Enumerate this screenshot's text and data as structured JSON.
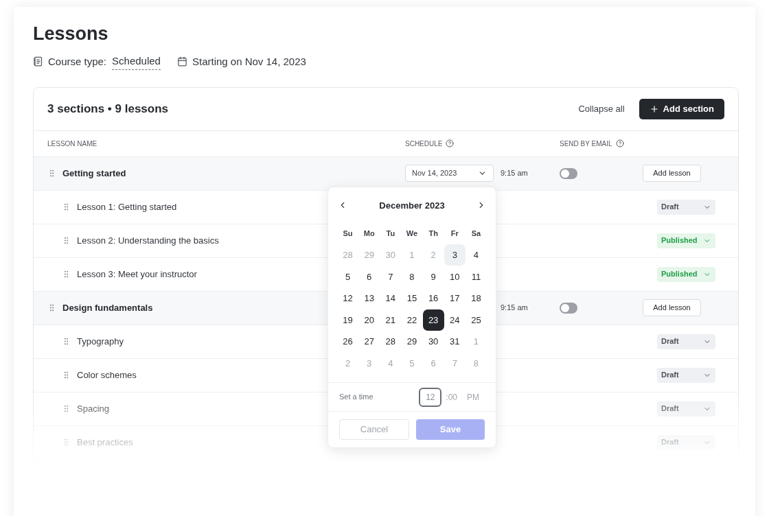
{
  "page": {
    "title": "Lessons",
    "course_type_label": "Course type:",
    "course_type": "Scheduled",
    "start": "Starting on Nov 14, 2023"
  },
  "table": {
    "summary": "3 sections • 9 lessons",
    "collapse": "Collapse all",
    "add_section": "Add section",
    "columns": [
      {
        "label": "LESSON NAME",
        "help": false
      },
      {
        "label": "SCHEDULE",
        "help": true
      },
      {
        "label": "SEND BY EMAIL",
        "help": true
      }
    ],
    "sections": [
      {
        "name": "Getting started",
        "date": "Nov 14, 2023",
        "time": "9:15 am",
        "email_on": false,
        "add": "Add lesson",
        "lessons": [
          {
            "name": "Lesson 1: Getting started",
            "status": "Draft",
            "kind": "draft"
          },
          {
            "name": "Lesson 2: Understanding the basics",
            "status": "Published",
            "kind": "published"
          },
          {
            "name": "Lesson 3: Meet your instructor",
            "status": "Published",
            "kind": "published"
          }
        ]
      },
      {
        "name": "Design fundamentals",
        "time": "9:15 am",
        "email_on": false,
        "add": "Add lesson",
        "lessons": [
          {
            "name": "Typography",
            "status": "Draft",
            "kind": "draft"
          },
          {
            "name": "Color schemes",
            "status": "Draft",
            "kind": "draft"
          },
          {
            "name": "Spacing",
            "status": "Draft",
            "kind": "draft"
          },
          {
            "name": "Best practices",
            "status": "Draft",
            "kind": "draft"
          }
        ]
      }
    ]
  },
  "calendar": {
    "month": "December 2023",
    "weekdays": [
      "Su",
      "Mo",
      "Tu",
      "We",
      "Th",
      "Fr",
      "Sa"
    ],
    "weeks": [
      [
        {
          "d": "28",
          "muted": true,
          "selected": false,
          "hovered": false
        },
        {
          "d": "29",
          "muted": true,
          "selected": false,
          "hovered": false
        },
        {
          "d": "30",
          "muted": true,
          "selected": false,
          "hovered": false
        },
        {
          "d": "1",
          "muted": true,
          "selected": false,
          "hovered": false
        },
        {
          "d": "2",
          "muted": true,
          "selected": false,
          "hovered": false
        },
        {
          "d": "3",
          "muted": false,
          "selected": false,
          "hovered": true
        },
        {
          "d": "4",
          "muted": false,
          "selected": false,
          "hovered": false
        }
      ],
      [
        {
          "d": "5",
          "muted": false,
          "selected": false,
          "hovered": false
        },
        {
          "d": "6",
          "muted": false,
          "selected": false,
          "hovered": false
        },
        {
          "d": "7",
          "muted": false,
          "selected": false,
          "hovered": false
        },
        {
          "d": "8",
          "muted": false,
          "selected": false,
          "hovered": false
        },
        {
          "d": "9",
          "muted": false,
          "selected": false,
          "hovered": false
        },
        {
          "d": "10",
          "muted": false,
          "selected": false,
          "hovered": false
        },
        {
          "d": "11",
          "muted": false,
          "selected": false,
          "hovered": false
        }
      ],
      [
        {
          "d": "12",
          "muted": false,
          "selected": false,
          "hovered": false
        },
        {
          "d": "13",
          "muted": false,
          "selected": false,
          "hovered": false
        },
        {
          "d": "14",
          "muted": false,
          "selected": false,
          "hovered": false
        },
        {
          "d": "15",
          "muted": false,
          "selected": false,
          "hovered": false
        },
        {
          "d": "16",
          "muted": false,
          "selected": false,
          "hovered": false
        },
        {
          "d": "17",
          "muted": false,
          "selected": false,
          "hovered": false
        },
        {
          "d": "18",
          "muted": false,
          "selected": false,
          "hovered": false
        }
      ],
      [
        {
          "d": "19",
          "muted": false,
          "selected": false,
          "hovered": false
        },
        {
          "d": "20",
          "muted": false,
          "selected": false,
          "hovered": false
        },
        {
          "d": "21",
          "muted": false,
          "selected": false,
          "hovered": false
        },
        {
          "d": "22",
          "muted": false,
          "selected": false,
          "hovered": false
        },
        {
          "d": "23",
          "muted": false,
          "selected": true,
          "hovered": false
        },
        {
          "d": "24",
          "muted": false,
          "selected": false,
          "hovered": false
        },
        {
          "d": "25",
          "muted": false,
          "selected": false,
          "hovered": false
        }
      ],
      [
        {
          "d": "26",
          "muted": false,
          "selected": false,
          "hovered": false
        },
        {
          "d": "27",
          "muted": false,
          "selected": false,
          "hovered": false
        },
        {
          "d": "28",
          "muted": false,
          "selected": false,
          "hovered": false
        },
        {
          "d": "29",
          "muted": false,
          "selected": false,
          "hovered": false
        },
        {
          "d": "30",
          "muted": false,
          "selected": false,
          "hovered": false
        },
        {
          "d": "31",
          "muted": false,
          "selected": false,
          "hovered": false
        },
        {
          "d": "1",
          "muted": true,
          "selected": false,
          "hovered": false
        }
      ],
      [
        {
          "d": "2",
          "muted": true,
          "selected": false,
          "hovered": false
        },
        {
          "d": "3",
          "muted": true,
          "selected": false,
          "hovered": false
        },
        {
          "d": "4",
          "muted": true,
          "selected": false,
          "hovered": false
        },
        {
          "d": "5",
          "muted": true,
          "selected": false,
          "hovered": false
        },
        {
          "d": "6",
          "muted": true,
          "selected": false,
          "hovered": false
        },
        {
          "d": "7",
          "muted": true,
          "selected": false,
          "hovered": false
        },
        {
          "d": "8",
          "muted": true,
          "selected": false,
          "hovered": false
        }
      ]
    ],
    "time_label": "Set a time",
    "hour": "12",
    "minutes": ":00",
    "meridiem": "PM",
    "cancel": "Cancel",
    "save": "Save",
    "save_disabled": true
  }
}
